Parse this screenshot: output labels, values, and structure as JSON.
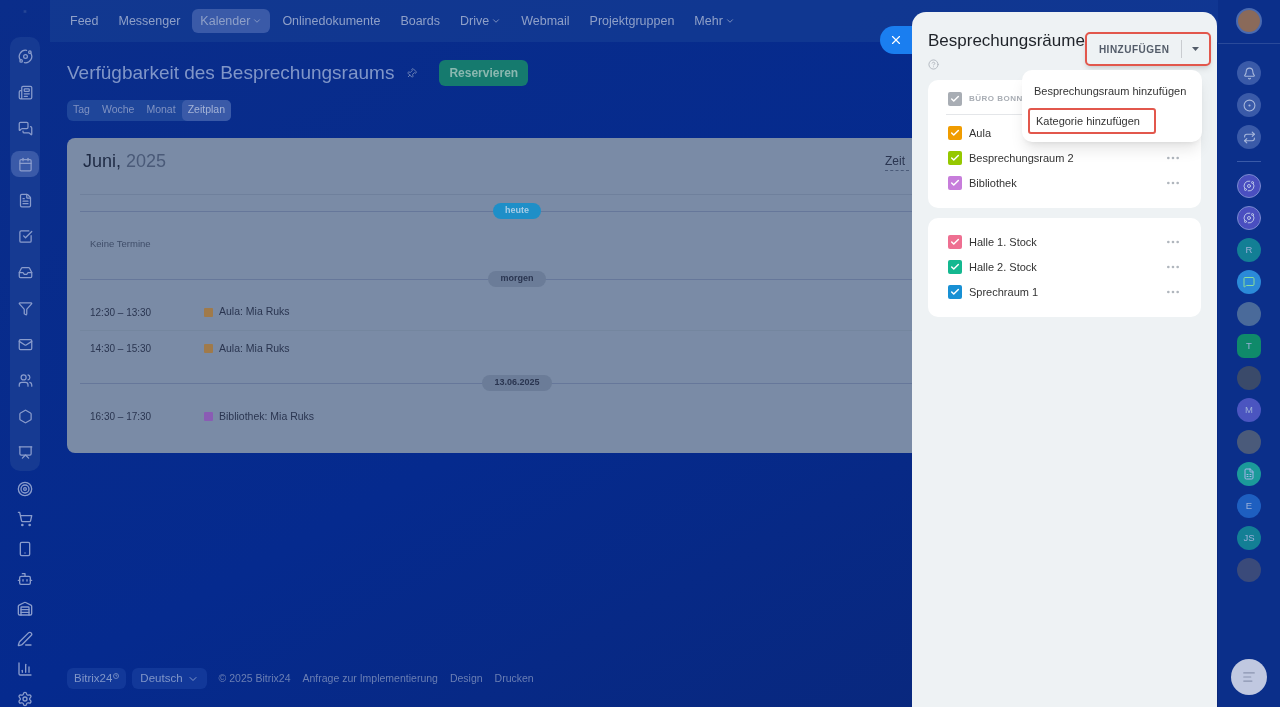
{
  "nav": {
    "items": [
      {
        "label": "Feed",
        "selected": false,
        "dropdown": false
      },
      {
        "label": "Messenger",
        "selected": false,
        "dropdown": false
      },
      {
        "label": "Kalender",
        "selected": true,
        "dropdown": true
      },
      {
        "label": "Onlinedokumente",
        "selected": false,
        "dropdown": false
      },
      {
        "label": "Boards",
        "selected": false,
        "dropdown": false
      },
      {
        "label": "Drive",
        "selected": false,
        "dropdown": true
      },
      {
        "label": "Webmail",
        "selected": false,
        "dropdown": false
      },
      {
        "label": "Projektgruppen",
        "selected": false,
        "dropdown": false
      },
      {
        "label": "Mehr",
        "selected": false,
        "dropdown": true
      }
    ]
  },
  "page": {
    "title": "Verfügbarkeit des Besprechungsraums",
    "reserve_button": "Reservieren",
    "view_tabs": [
      {
        "label": "Tag",
        "selected": false
      },
      {
        "label": "Woche",
        "selected": false
      },
      {
        "label": "Monat",
        "selected": false
      },
      {
        "label": "Zeitplan",
        "selected": true
      }
    ]
  },
  "calendar": {
    "month": "Juni,",
    "year": "2025",
    "view_link": "Zeit",
    "groups": [
      {
        "label": "heute",
        "today": true,
        "empty_text": "Keine Termine"
      },
      {
        "label": "morgen",
        "today": false,
        "events": [
          {
            "time": "12:30 – 13:30",
            "title": "Aula: Mia Ruks",
            "color": "#a07a4a"
          },
          {
            "time": "14:30 – 15:30",
            "title": "Aula: Mia Ruks",
            "color": "#a07a4a"
          }
        ]
      },
      {
        "label": "13.06.2025",
        "today": false,
        "events": [
          {
            "time": "16:30 – 17:30",
            "title": "Bibliothek: Mia Ruks",
            "color": "#8a5cb4"
          }
        ]
      }
    ]
  },
  "footer": {
    "brand": "Bitrix24",
    "language": "Deutsch",
    "links": [
      "© 2025 Bitrix24",
      "Anfrage zur Implementierung",
      "Design",
      "Drucken"
    ]
  },
  "panel": {
    "title": "Besprechungsräume",
    "add_button": {
      "label": "HINZUFÜGEN",
      "highlighted": true
    },
    "menu": [
      {
        "label": "Besprechungsraum hinzufügen",
        "highlighted": false
      },
      {
        "label": "Kategorie hinzufügen",
        "highlighted": true
      }
    ],
    "sections": [
      {
        "category": {
          "label": "BÜRO BONN",
          "checked": true
        },
        "rooms": [
          {
            "name": "Aula",
            "checked": true,
            "color": "#f09c00"
          },
          {
            "name": "Besprechungsraum 2",
            "checked": true,
            "color": "#95c800"
          },
          {
            "name": "Bibliothek",
            "checked": true,
            "color": "#c77ddb"
          }
        ]
      },
      {
        "rooms": [
          {
            "name": "Halle 1. Stock",
            "checked": true,
            "color": "#ee6f91"
          },
          {
            "name": "Halle 2. Stock",
            "checked": true,
            "color": "#14b890"
          },
          {
            "name": "Sprechraum 1",
            "checked": true,
            "color": "#1890d4"
          }
        ]
      }
    ]
  },
  "right_bar": {
    "contacts": [
      {
        "kind": "bot",
        "color": "#4a4fc0"
      },
      {
        "kind": "bot",
        "color": "#4a4fc0"
      },
      {
        "kind": "letter",
        "label": "R",
        "color": "#137f95"
      },
      {
        "kind": "chat",
        "color": "#2b8ad8"
      },
      {
        "kind": "photo",
        "color": "#4a6a9a"
      },
      {
        "kind": "hex",
        "label": "T",
        "color": "#0f8a6a"
      },
      {
        "kind": "photo",
        "color": "#3a4a6a"
      },
      {
        "kind": "letter",
        "label": "M",
        "color": "#4b55c0"
      },
      {
        "kind": "photo",
        "color": "#4a5a7a"
      },
      {
        "kind": "doc",
        "color": "#1b9a9a"
      },
      {
        "kind": "letter",
        "label": "E",
        "color": "#1e5fc0"
      },
      {
        "kind": "letter",
        "label": "JS",
        "color": "#137f95"
      },
      {
        "kind": "photo",
        "color": "#3a4a7a"
      }
    ]
  }
}
